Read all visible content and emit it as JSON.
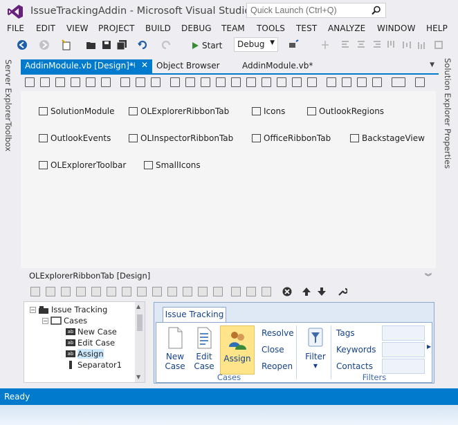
{
  "window": {
    "title": "IssueTrackingAddin - Microsoft Visual Studio...",
    "quick_launch_placeholder": "Quick Launch (Ctrl+Q)"
  },
  "menu": [
    "FILE",
    "EDIT",
    "VIEW",
    "PROJECT",
    "BUILD",
    "DEBUG",
    "TEAM",
    "TOOLS",
    "TEST",
    "ANALYZE",
    "WINDOW",
    "HELP"
  ],
  "toolbar": {
    "start_label": "Start",
    "configuration": "Debug"
  },
  "left_sidebar": [
    "Server Explorer",
    "Toolbox"
  ],
  "right_sidebar": [
    "Solution Explorer",
    "Properties"
  ],
  "tabs": [
    {
      "label": "AddinModule.vb [Design]*",
      "active": true
    },
    {
      "label": "Object Browser",
      "active": false
    },
    {
      "label": "AddinModule.vb*",
      "active": false
    }
  ],
  "components": [
    "SolutionModule",
    "OLExplorerRibbonTab",
    "Icons",
    "OutlookRegions",
    "OutlookEvents",
    "OLInspectorRibbonTab",
    "OfficeRibbonTab",
    "BackstageView",
    "OLExplorerToolbar",
    "SmallIcons"
  ],
  "ribbon_designer": {
    "header": "OLExplorerRibbonTab [Design]"
  },
  "tree": [
    {
      "label": "Issue Tracking",
      "level": 0,
      "expander": "−",
      "icon": "tab"
    },
    {
      "label": "Cases",
      "level": 1,
      "expander": "−",
      "icon": "group"
    },
    {
      "label": "New Case",
      "level": 2,
      "icon": "ab"
    },
    {
      "label": "Edit Case",
      "level": 2,
      "icon": "ab"
    },
    {
      "label": "Assign",
      "level": 2,
      "icon": "ab",
      "selected": true
    },
    {
      "label": "Separator1",
      "level": 2,
      "icon": "sep"
    }
  ],
  "ribbon_preview": {
    "tab": "Issue Tracking",
    "buttons": {
      "new_case": "New Case",
      "edit_case": "Edit Case",
      "assign": "Assign",
      "resolve": "Resolve",
      "close": "Close",
      "reopen": "Reopen",
      "filter": "Filter"
    },
    "fields": [
      "Tags",
      "Keywords",
      "Contacts"
    ],
    "groups": [
      "Cases",
      "Filters"
    ]
  },
  "status": "Ready",
  "colors": {
    "accent": "#007acc",
    "ribbon_text": "#15428b",
    "selected_button": "#ffe48a"
  }
}
